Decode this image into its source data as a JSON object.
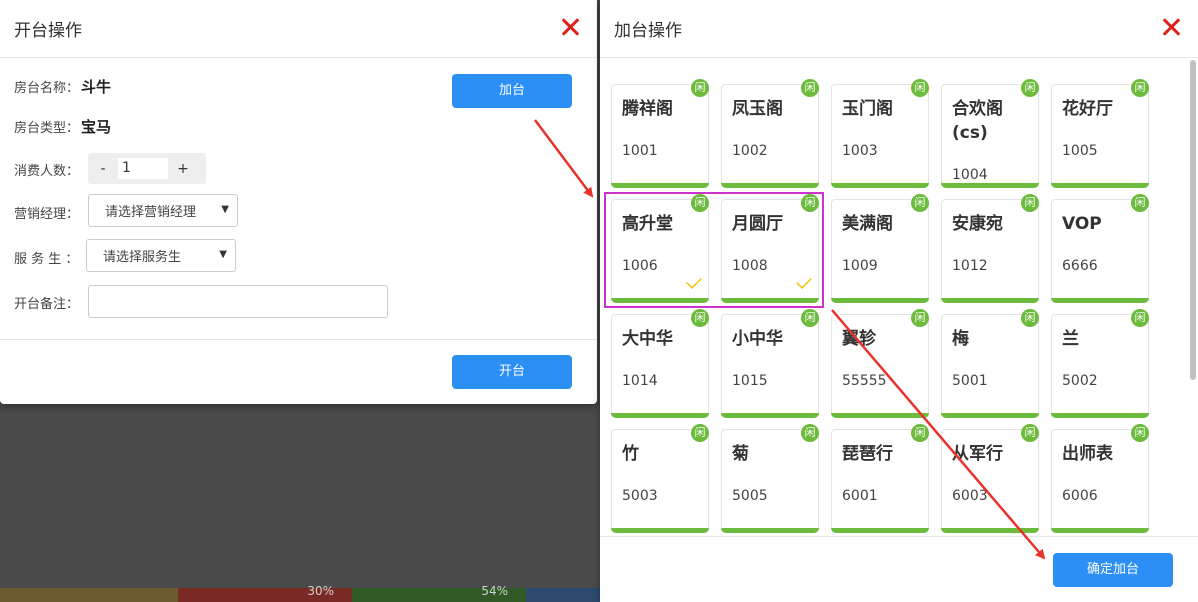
{
  "background": {
    "segments": [
      {
        "color": "#6b5a2e",
        "label": ""
      },
      {
        "color": "#7a2a24",
        "label": "30%"
      },
      {
        "color": "#2f5a26",
        "label": "54%"
      },
      {
        "color": "#2b4a6e",
        "label": ""
      }
    ]
  },
  "open_dialog": {
    "title": "开台操作",
    "room_name_label": "房台名称：",
    "room_name_value": "斗牛",
    "room_type_label": "房台类型：",
    "room_type_value": "宝马",
    "people_label": "消费人数：",
    "people_minus": "-",
    "people_value": "1",
    "people_plus": "+",
    "manager_label": "营销经理：",
    "manager_select": "请选择营销经理",
    "waiter_label": "服 务 生 ：",
    "waiter_select": "请选择服务生",
    "remark_label": "开台备注：",
    "remark_value": "",
    "add_button": "加台",
    "open_button": "开台"
  },
  "add_dialog": {
    "title": "加台操作",
    "confirm_button": "确定加台",
    "idle_badge": "闲",
    "rooms": [
      {
        "name": "腾祥阁",
        "number": "1001",
        "selected": false
      },
      {
        "name": "凤玉阁",
        "number": "1002",
        "selected": false
      },
      {
        "name": "玉门阁",
        "number": "1003",
        "selected": false
      },
      {
        "name": "合欢阁(cs)",
        "number": "1004",
        "selected": false
      },
      {
        "name": "花好厅",
        "number": "1005",
        "selected": false
      },
      {
        "name": "高升堂",
        "number": "1006",
        "selected": true
      },
      {
        "name": "月圆厅",
        "number": "1008",
        "selected": true
      },
      {
        "name": "美满阁",
        "number": "1009",
        "selected": false
      },
      {
        "name": "安康宛",
        "number": "1012",
        "selected": false
      },
      {
        "name": "VOP",
        "number": "6666",
        "selected": false
      },
      {
        "name": "大中华",
        "number": "1014",
        "selected": false
      },
      {
        "name": "小中华",
        "number": "1015",
        "selected": false
      },
      {
        "name": "翼轸",
        "number": "55555",
        "selected": false
      },
      {
        "name": "梅",
        "number": "5001",
        "selected": false
      },
      {
        "name": "兰",
        "number": "5002",
        "selected": false
      },
      {
        "name": "竹",
        "number": "5003",
        "selected": false
      },
      {
        "name": "菊",
        "number": "5005",
        "selected": false
      },
      {
        "name": "琵琶行",
        "number": "6001",
        "selected": false
      },
      {
        "name": "从军行",
        "number": "6003",
        "selected": false
      },
      {
        "name": "出师表",
        "number": "6006",
        "selected": false
      }
    ]
  },
  "colors": {
    "accent": "#2b8ff5",
    "idle_green": "#6cbb3c",
    "close_red": "#e0201a",
    "highlight": "#cc33cc",
    "check_yellow": "#f2c200",
    "arrow_red": "#e8332c"
  }
}
